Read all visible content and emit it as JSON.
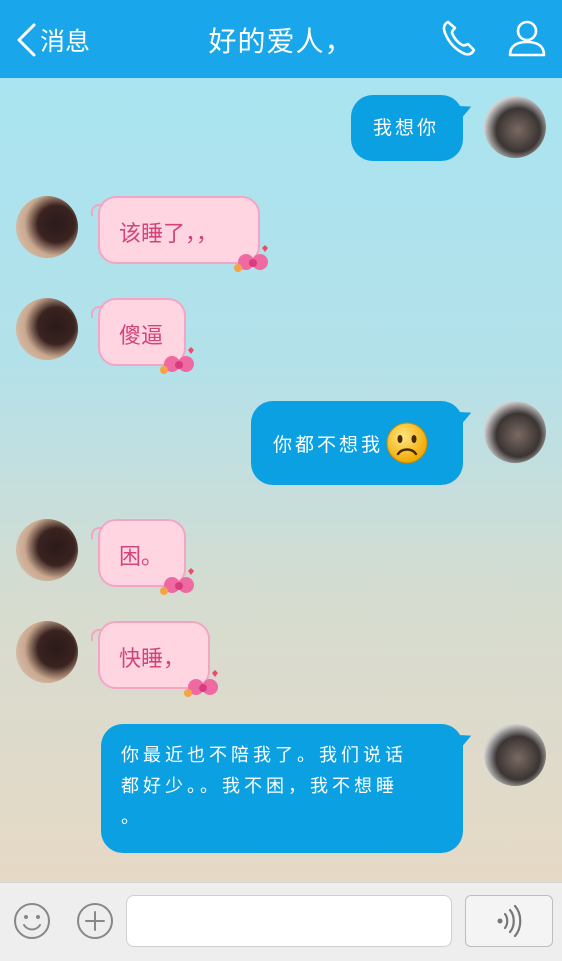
{
  "header": {
    "back_label": "消息",
    "title": "好的爱人，",
    "icons": [
      "chevron-left-icon",
      "phone-icon",
      "profile-icon"
    ]
  },
  "messages": [
    {
      "from": "me",
      "text": "我想你"
    },
    {
      "from": "her",
      "text": "该睡了，，"
    },
    {
      "from": "her",
      "text": "傻逼"
    },
    {
      "from": "me",
      "text": "你都不想我",
      "emoji": "sad-face-icon"
    },
    {
      "from": "her",
      "text": "困。"
    },
    {
      "from": "her",
      "text": "快睡，"
    },
    {
      "from": "me",
      "lines": [
        "你最近也不陪我了。我们说话",
        "都好少。。我不困，我不想睡",
        "。"
      ]
    }
  ],
  "input": {
    "value": "",
    "placeholder": ""
  },
  "footer_icons": [
    "smiley-icon",
    "plus-icon",
    "voice-icon"
  ],
  "colors": {
    "header": "#19a6ea",
    "outgoing_bubble": "#0aa0e2",
    "incoming_bubble": "#ffd5e2",
    "incoming_text": "#d0457a"
  }
}
